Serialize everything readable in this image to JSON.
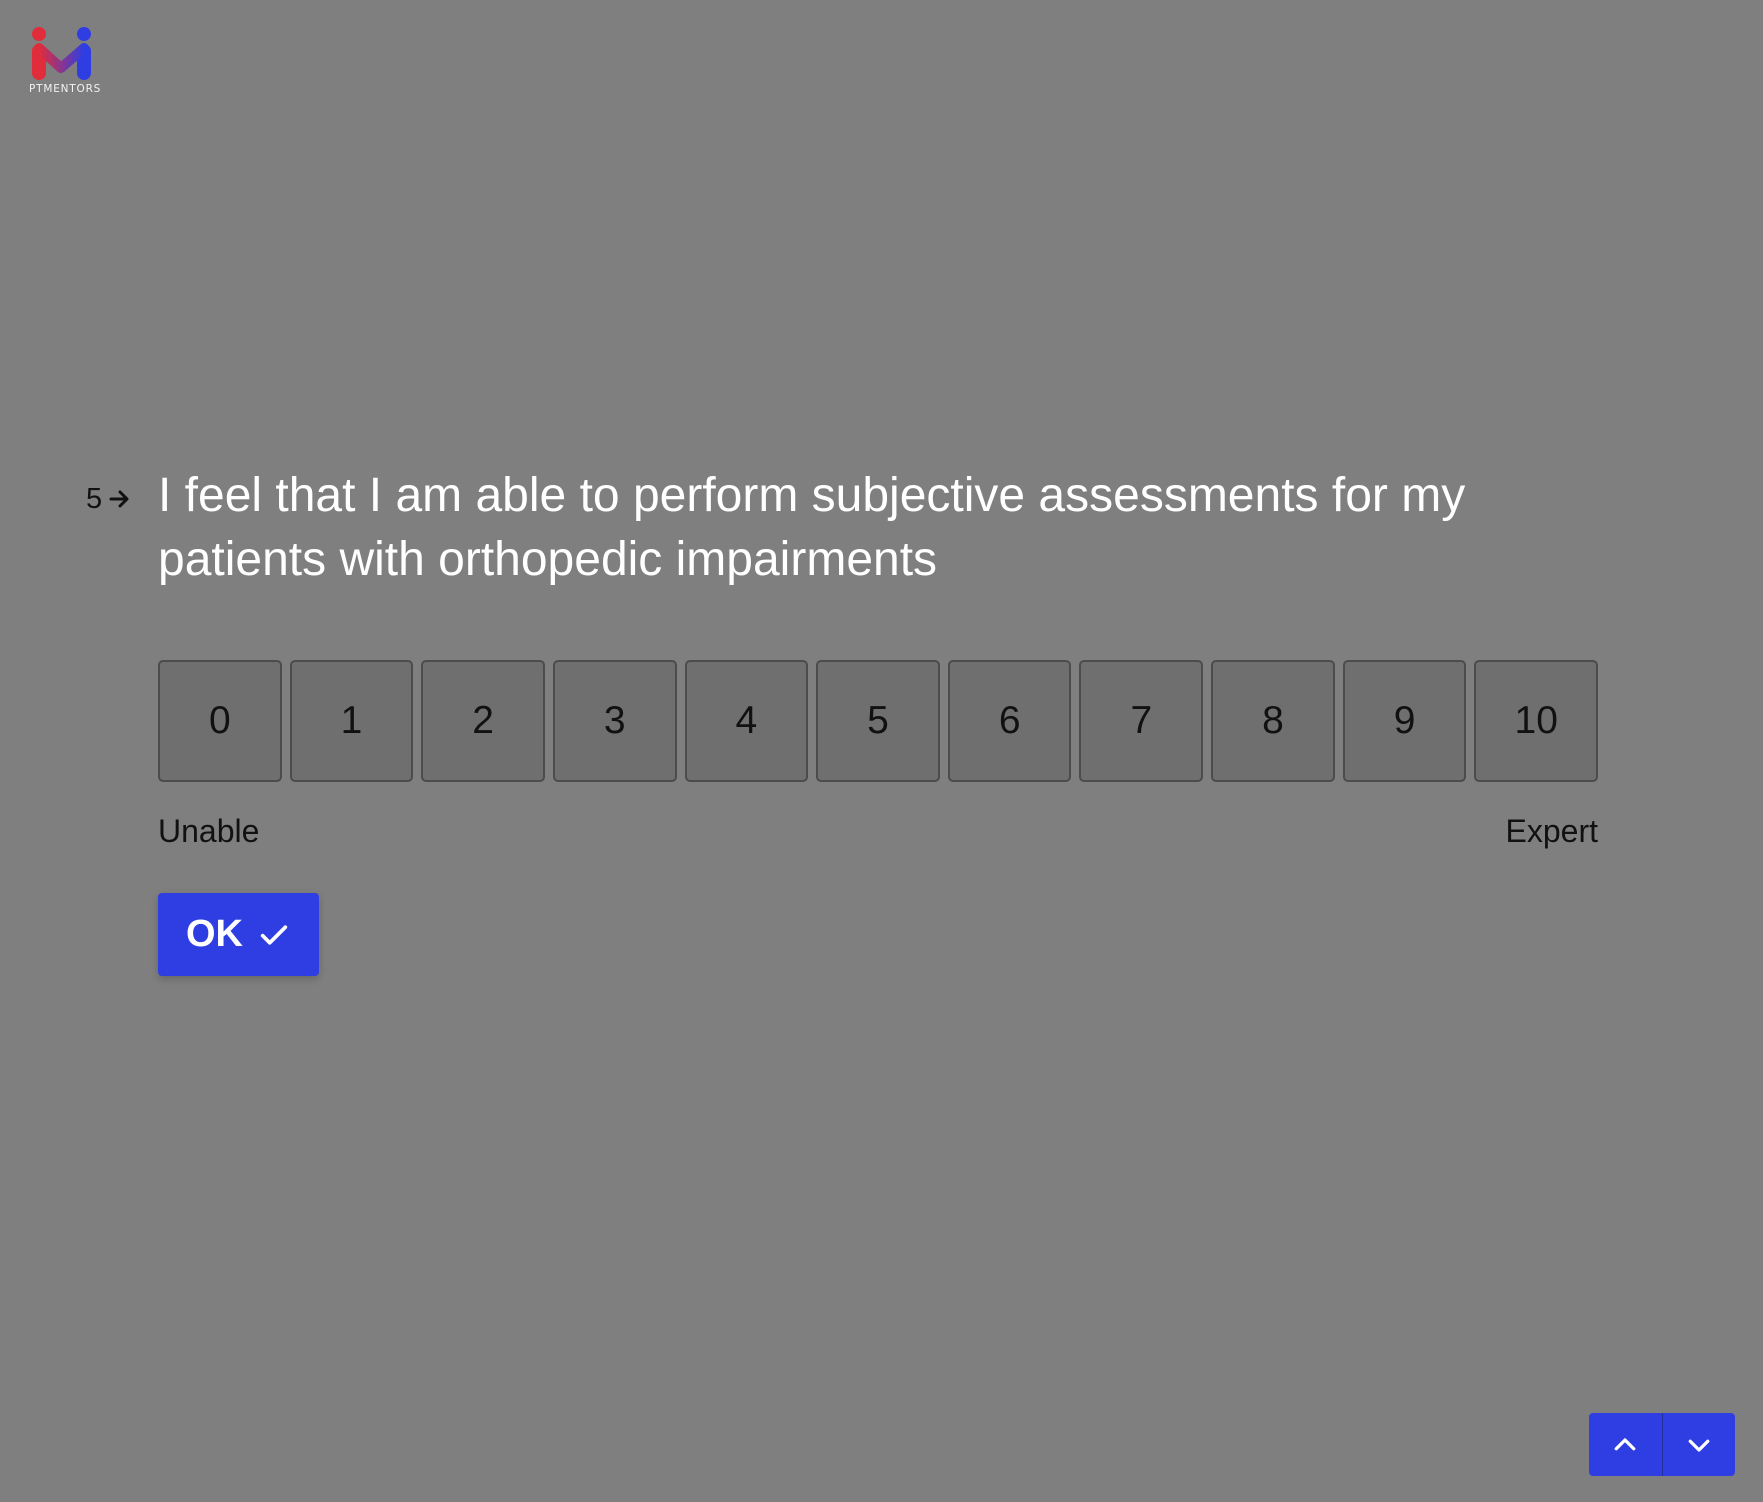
{
  "brand": {
    "name": "PTMENTORS",
    "colors": {
      "red": "#e12d3b",
      "blue": "#2f3ee2"
    }
  },
  "question": {
    "number": "5",
    "text": "I feel that I am able to perform subjective assessments for my patients with orthopedic impairments"
  },
  "scale": {
    "options": [
      "0",
      "1",
      "2",
      "3",
      "4",
      "5",
      "6",
      "7",
      "8",
      "9",
      "10"
    ],
    "labels": {
      "left": "Unable",
      "right": "Expert"
    }
  },
  "actions": {
    "ok_label": "OK",
    "ok_icon": "check-icon",
    "prev_icon": "chevron-up-icon",
    "next_icon": "chevron-down-icon"
  },
  "theme": {
    "background": "#7f7f7f",
    "text_primary": "#ffffff",
    "text_secondary": "#111111",
    "option_border": "#4c4c4c"
  }
}
